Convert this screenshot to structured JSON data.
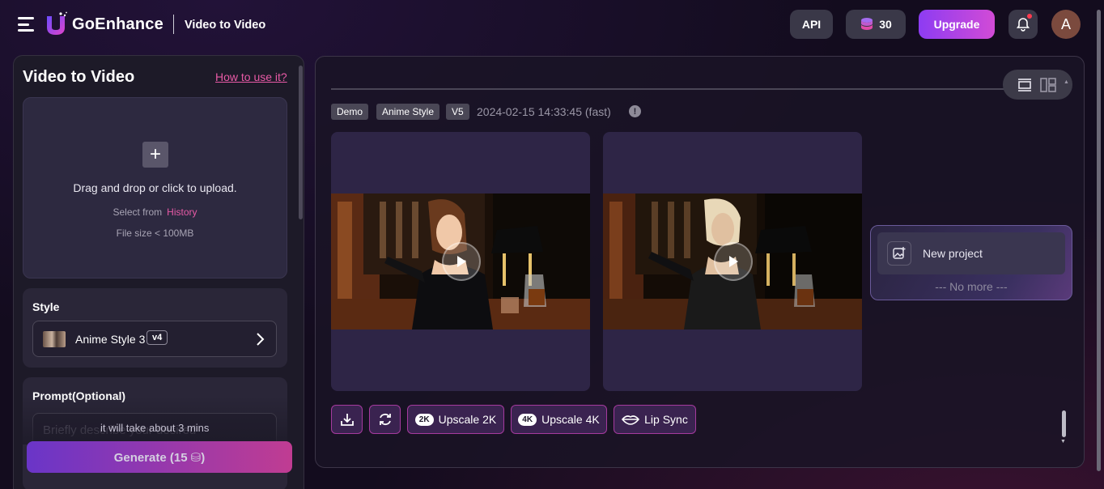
{
  "header": {
    "brand": "GoEnhance",
    "page_title": "Video to Video",
    "api_label": "API",
    "credits": "30",
    "upgrade_label": "Upgrade",
    "avatar_initial": "A",
    "accent_color": "#d24bd6"
  },
  "left_panel": {
    "title": "Video to Video",
    "how_to_link": "How to use it?",
    "upload": {
      "drag_text": "Drag and drop or click to upload.",
      "select_from": "Select from",
      "history_link": "History",
      "file_size": "File size < 100MB"
    },
    "style": {
      "label": "Style",
      "selected_name": "Anime Style 3",
      "version": "v4"
    },
    "prompt": {
      "label": "Prompt(Optional)",
      "placeholder": "Briefly describe your desired"
    },
    "eta_text": "it will take about 3 mins",
    "generate_label": "Generate (15 ⛁)"
  },
  "main": {
    "tags": [
      "Demo",
      "Anime Style",
      "V5"
    ],
    "timestamp": "2024-02-15 14:33:45 (fast)",
    "info_icon": "!",
    "actions": {
      "upscale_2k_badge": "2K",
      "upscale_2k": "Upscale 2K",
      "upscale_4k_badge": "4K",
      "upscale_4k": "Upscale 4K",
      "lip_sync": "Lip Sync"
    },
    "new_project_label": "New project",
    "no_more_text": "--- No more ---"
  }
}
